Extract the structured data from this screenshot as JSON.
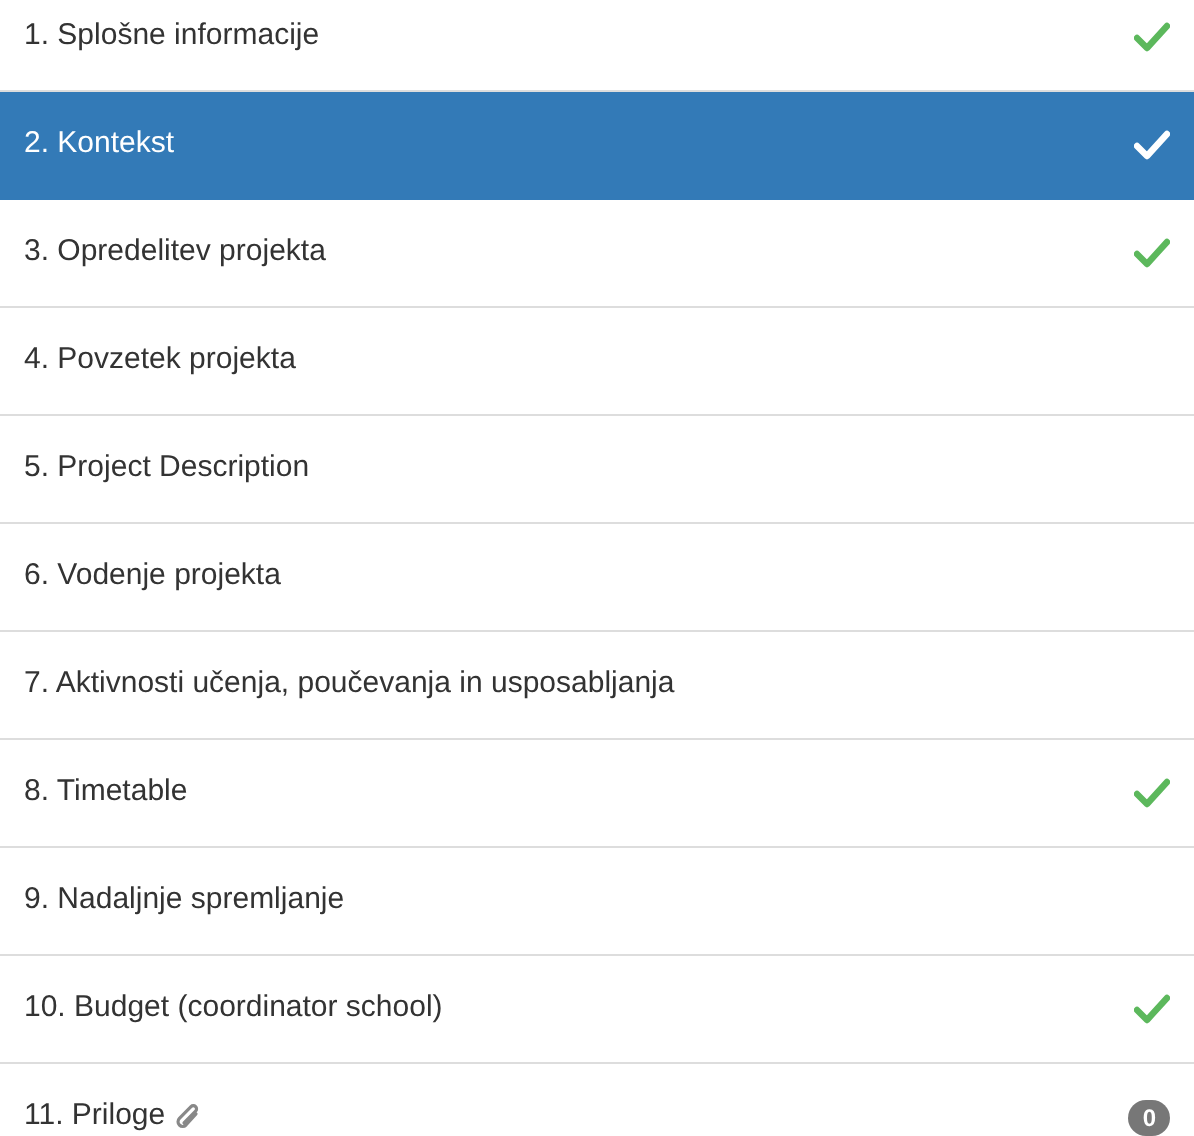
{
  "steps": [
    {
      "label": "1. Splošne informacije",
      "selected": false,
      "checked": true
    },
    {
      "label": "2. Kontekst",
      "selected": true,
      "checked": true
    },
    {
      "label": "3. Opredelitev projekta",
      "selected": false,
      "checked": true
    },
    {
      "label": "4. Povzetek projekta",
      "selected": false,
      "checked": false
    },
    {
      "label": "5. Project Description",
      "selected": false,
      "checked": false
    },
    {
      "label": "6. Vodenje projekta",
      "selected": false,
      "checked": false
    },
    {
      "label": "7. Aktivnosti učenja, poučevanja in usposabljanja",
      "selected": false,
      "checked": false
    },
    {
      "label": "8. Timetable",
      "selected": false,
      "checked": true
    },
    {
      "label": "9. Nadaljnje spremljanje",
      "selected": false,
      "checked": false
    },
    {
      "label": "10. Budget (coordinator school)",
      "selected": false,
      "checked": true
    },
    {
      "label": "11. Priloge",
      "selected": false,
      "checked": false,
      "kind": "attachments",
      "badge": "0"
    }
  ]
}
